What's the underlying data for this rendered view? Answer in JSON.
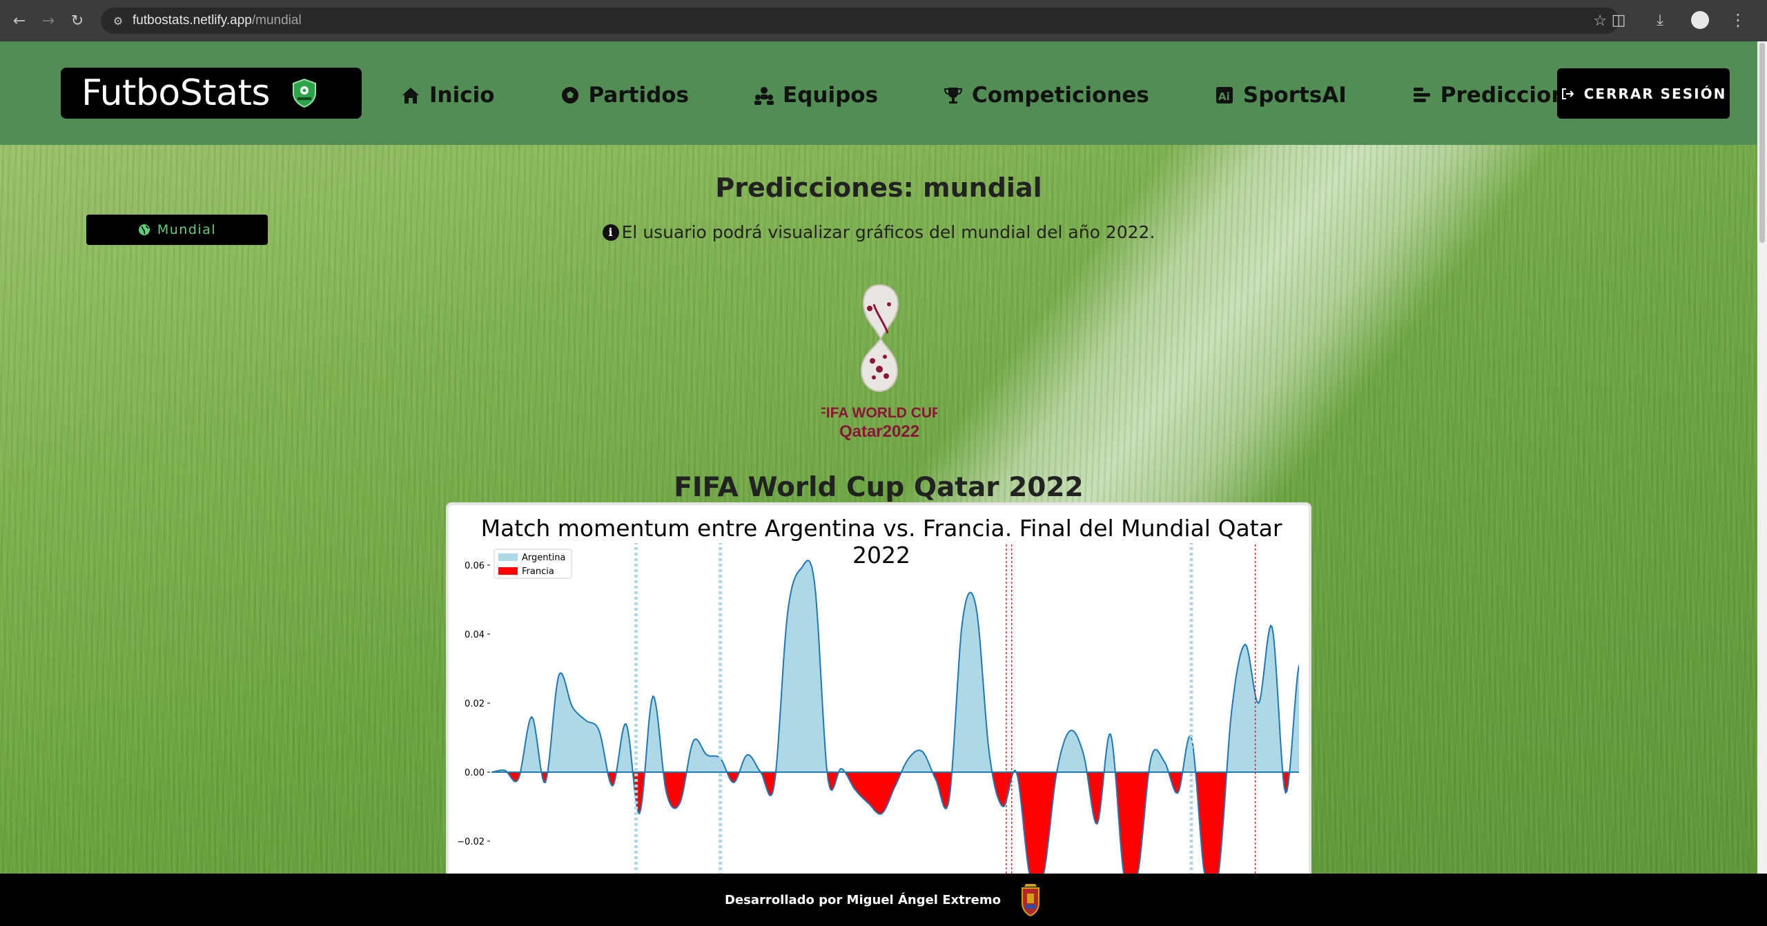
{
  "browser": {
    "url_host": "futbostats.netlify.app",
    "url_path": "/mundial"
  },
  "header": {
    "brand": "FutboStats",
    "nav": [
      {
        "label": "Inicio",
        "icon": "home-icon"
      },
      {
        "label": "Partidos",
        "icon": "soccer-ball-icon"
      },
      {
        "label": "Equipos",
        "icon": "team-icon"
      },
      {
        "label": "Competiciones",
        "icon": "trophy-icon"
      },
      {
        "label": "SportsAI",
        "icon": "ai-icon"
      },
      {
        "label": "Predicciones",
        "icon": "bars-icon"
      }
    ],
    "logout_label": "CERRAR SESIÓN"
  },
  "main": {
    "title": "Predicciones: mundial",
    "filter_label": "Mundial",
    "info_text": "El usuario podrá visualizar gráficos del mundial del año 2022.",
    "logo_line1": "FIFA WORLD CUP",
    "logo_line2": "Qatar2022",
    "tournament_name": "FIFA World Cup Qatar 2022"
  },
  "chart_data": {
    "type": "area",
    "title": "Match momentum entre Argentina vs. Francia. Final del Mundial Qatar 2022",
    "series": [
      {
        "name": "Argentina",
        "color": "#add8e6"
      },
      {
        "name": "Francia",
        "color": "#ff0000"
      }
    ],
    "yticks": [
      "0.06",
      "0.04",
      "0.02",
      "0.00",
      "−0.02"
    ],
    "ylim_visible": [
      -0.029,
      0.063
    ],
    "x": [
      0,
      2,
      4,
      6,
      8,
      10,
      12,
      14,
      16,
      18,
      20,
      22,
      24,
      26,
      28,
      30,
      32,
      34,
      36,
      38,
      40,
      42,
      44,
      46,
      48,
      50,
      52,
      54,
      56,
      58,
      60,
      62,
      64,
      66,
      68,
      70,
      72,
      74,
      76,
      78,
      80,
      82,
      84,
      86,
      88,
      90,
      92,
      94,
      96,
      98,
      100,
      102,
      104,
      106,
      108,
      110,
      112,
      114,
      116,
      118,
      120
    ],
    "momentum": [
      0.0,
      0.0005,
      -0.002,
      0.016,
      -0.003,
      0.028,
      0.019,
      0.015,
      0.012,
      -0.004,
      0.014,
      -0.012,
      0.022,
      -0.006,
      -0.009,
      0.009,
      0.005,
      0.004,
      -0.003,
      0.005,
      0.0,
      -0.004,
      0.046,
      0.059,
      0.055,
      -0.002,
      0.001,
      -0.005,
      -0.009,
      -0.012,
      -0.004,
      0.004,
      0.006,
      -0.002,
      -0.008,
      0.044,
      0.048,
      0.005,
      -0.01,
      0.0,
      -0.03,
      -0.03,
      0.0,
      0.012,
      0.005,
      -0.015,
      0.011,
      -0.03,
      -0.03,
      0.004,
      0.003,
      -0.006,
      0.01,
      -0.03,
      -0.03,
      0.018,
      0.037,
      0.02,
      0.042,
      -0.006,
      0.031
    ],
    "vlines_blue": [
      21.5,
      34,
      104
    ],
    "vlines_red": [
      76.5,
      77.3,
      113.5
    ]
  },
  "footer": {
    "text": "Desarrollado por Miguel Ángel Extremo"
  }
}
